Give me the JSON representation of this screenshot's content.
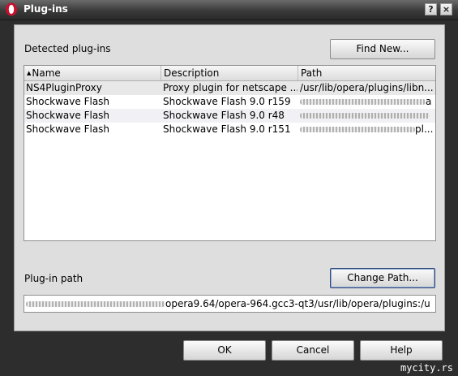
{
  "window": {
    "title": "Plug-ins",
    "help_glyph": "?",
    "close_glyph": "×",
    "icon": "opera-logo-icon"
  },
  "plugins_section": {
    "label": "Detected plug-ins",
    "find_new_label": "Find New..."
  },
  "table": {
    "columns": [
      "Name",
      "Description",
      "Path"
    ],
    "sorted_column": "Name",
    "rows": [
      {
        "name": "NS4PluginProxy",
        "description": "Proxy plugin for netscape ...",
        "path_visible": "/usr/lib/opera/plugins/libn..."
      },
      {
        "name": "Shockwave Flash",
        "description": "Shockwave Flash 9.0 r159",
        "path_visible": "a"
      },
      {
        "name": "Shockwave Flash",
        "description": "Shockwave Flash 9.0 r48",
        "path_visible": ""
      },
      {
        "name": "Shockwave Flash",
        "description": "Shockwave Flash 9.0 r151",
        "path_visible": "pl..."
      }
    ]
  },
  "path_section": {
    "label": "Plug-in path",
    "change_path_label": "Change Path...",
    "path_value_visible": "opera9.64/opera-964.gcc3-qt3/usr/lib/opera/plugins:/u"
  },
  "buttons": {
    "ok": "OK",
    "cancel": "Cancel",
    "help": "Help"
  },
  "watermark": "mycity.rs"
}
